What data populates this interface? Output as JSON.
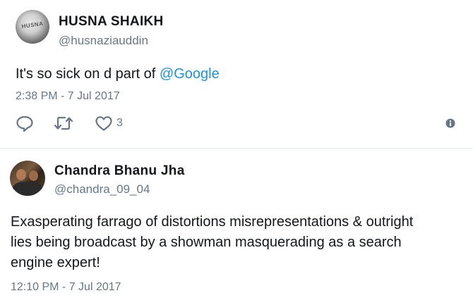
{
  "tweets": [
    {
      "name": "HUSNA SHAIKH",
      "handle": "@husnaziauddin",
      "avatar_text": "HUSNA",
      "text_prefix": "It's so sick on d part of ",
      "mention": "@Google",
      "timestamp": "2:38 PM - 7 Jul 2017",
      "actions": {
        "reply_icon": "reply-icon",
        "retweet_icon": "retweet-icon",
        "like_icon": "heart-icon",
        "like_count": "3",
        "info_icon": "info-icon"
      }
    },
    {
      "name": "Chandra Bhanu Jha",
      "handle": "@chandra_09_04",
      "text_line1": "Exasperating farrago of distortions misrepresentations & outright",
      "text_line2": "lies being broadcast by a showman masquerading as a search",
      "text_line3": "engine expert!",
      "timestamp": "12:10 PM - 7 Jul 2017"
    }
  ],
  "colors": {
    "text": "#14171a",
    "secondary": "#657786",
    "link": "#1b95e0",
    "divider": "#e6ecf0"
  }
}
